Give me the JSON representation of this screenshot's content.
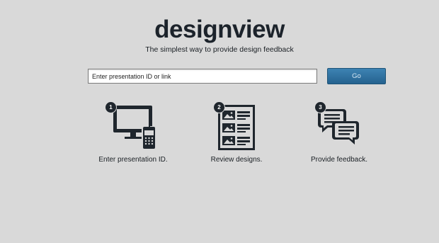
{
  "header": {
    "logo": "designview",
    "tagline": "The simplest way to provide design feedback"
  },
  "search": {
    "placeholder": "Enter presentation ID or link",
    "button_label": "Go"
  },
  "steps": [
    {
      "number": "1",
      "label": "Enter presentation ID.",
      "icon": "monitor-phone-icon"
    },
    {
      "number": "2",
      "label": "Review designs.",
      "icon": "document-images-icon"
    },
    {
      "number": "3",
      "label": "Provide feedback.",
      "icon": "chat-bubbles-icon"
    }
  ]
}
